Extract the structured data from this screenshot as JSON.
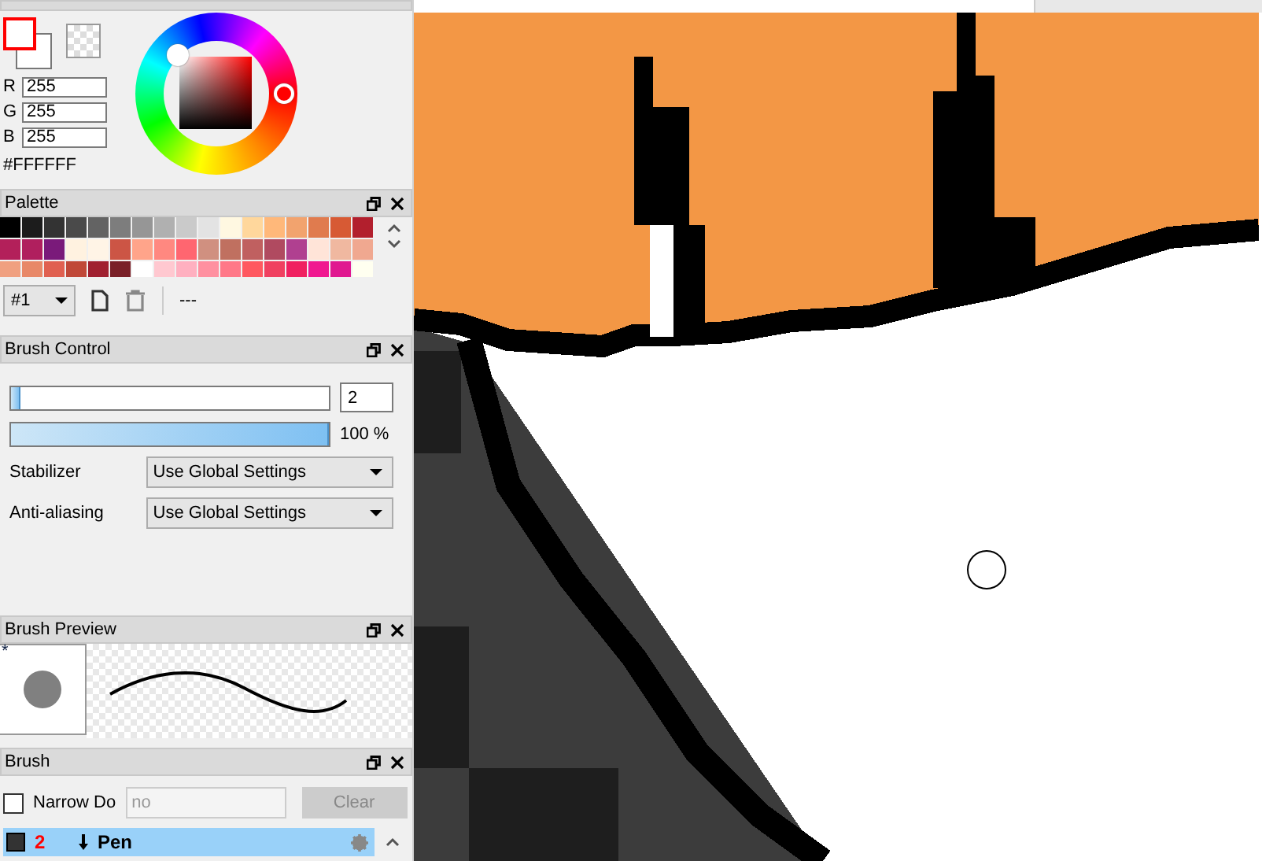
{
  "color_panel": {
    "channels": [
      {
        "label": "R",
        "value": "255"
      },
      {
        "label": "G",
        "value": "255"
      },
      {
        "label": "B",
        "value": "255"
      }
    ],
    "hex": "#FFFFFF"
  },
  "palette": {
    "title": "Palette",
    "swatches": [
      {
        "color": "#000000"
      },
      {
        "color": "#1c1c1c"
      },
      {
        "color": "#333333"
      },
      {
        "color": "#4a4a4a"
      },
      {
        "color": "#636363"
      },
      {
        "color": "#7d7d7d"
      },
      {
        "color": "#969696"
      },
      {
        "color": "#b0b0b0"
      },
      {
        "color": "#cacaca"
      },
      {
        "color": "#e3e3e3"
      },
      {
        "color": "#fff8e1"
      },
      {
        "color": "#ffd79c"
      },
      {
        "color": "#ffb87a"
      },
      {
        "color": "#f2a36e"
      },
      {
        "color": "#e07b4e"
      },
      {
        "color": "#d75a34"
      },
      {
        "color": "#b21f2d"
      },
      {
        "color": "#b3205a"
      },
      {
        "color": "#b01f5e"
      },
      {
        "color": "#7a1a7a"
      },
      {
        "color": "#fff2e0"
      },
      {
        "color": "#fff4e6"
      },
      {
        "color": "#cc5545"
      },
      {
        "color": "#ffa48a"
      },
      {
        "color": "#ff8880"
      },
      {
        "color": "#ff6670"
      },
      {
        "color": "#d09080"
      },
      {
        "color": "#c07060"
      },
      {
        "color": "#c06060"
      },
      {
        "color": "#b04a60"
      },
      {
        "color": "#b04090"
      },
      {
        "color": "#ffe4d8"
      },
      {
        "color": "#f0b8a0"
      },
      {
        "color": "#f0a890"
      },
      {
        "color": "#f0a080"
      },
      {
        "color": "#e88868"
      },
      {
        "color": "#e06050"
      },
      {
        "color": "#c04838"
      },
      {
        "color": "#a02030"
      },
      {
        "color": "#7a2028"
      },
      {
        "color": "#ffffff"
      },
      {
        "color": "#ffc8d0"
      },
      {
        "color": "#ffb0c0"
      },
      {
        "color": "#ff90a0"
      },
      {
        "color": "#ff7888"
      },
      {
        "color": "#ff5860"
      },
      {
        "color": "#f04060"
      },
      {
        "color": "#f02060"
      },
      {
        "color": "#f01890"
      },
      {
        "color": "#e01890"
      },
      {
        "color": "#fffff0"
      }
    ],
    "set": "#1",
    "name": "---"
  },
  "brush_control": {
    "title": "Brush Control",
    "size": {
      "level": 0.02,
      "value": "2"
    },
    "opacity": {
      "level": 1,
      "reading": "100 %"
    },
    "settings": [
      {
        "label": "Stabilizer",
        "value": "Use Global Settings"
      },
      {
        "label": "Anti-aliasing",
        "value": "Use Global Settings"
      }
    ]
  },
  "brush_preview": {
    "title": "Brush Preview",
    "mark": "*"
  },
  "brush": {
    "title": "Brush",
    "filter": {
      "label": "Narrow Do",
      "checked": false,
      "placeholder": "no"
    },
    "clear": {
      "label": "Clear",
      "disabled": true
    },
    "items": [
      {
        "number": "2",
        "name": "Pen",
        "selected": true
      }
    ]
  }
}
